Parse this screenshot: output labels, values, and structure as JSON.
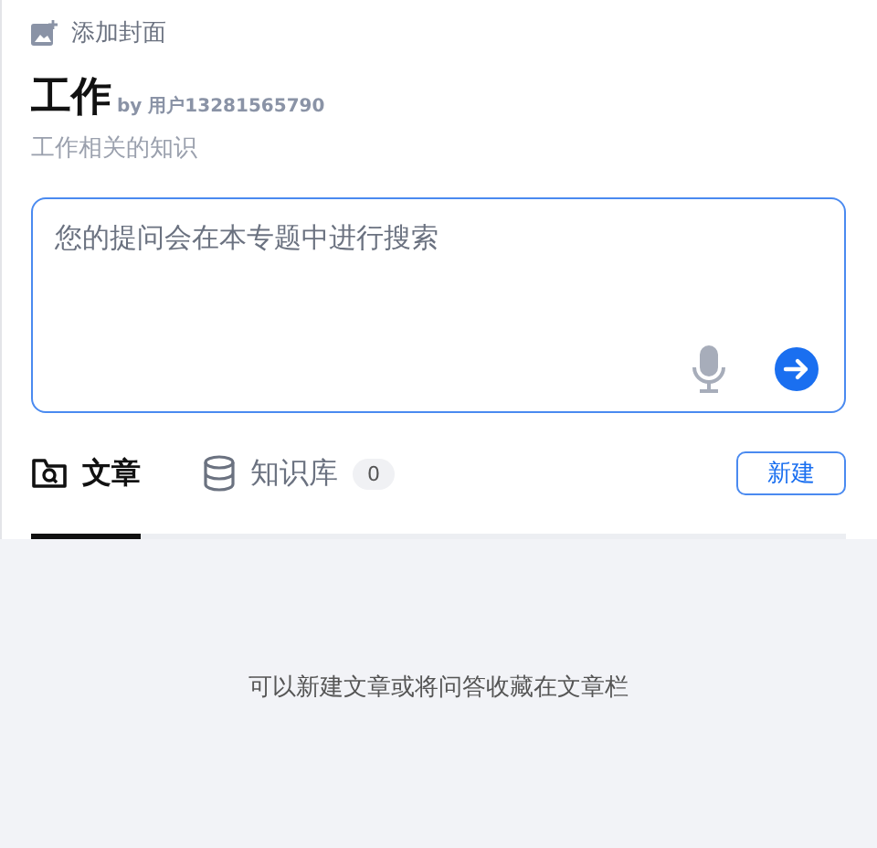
{
  "cover": {
    "label": "添加封面"
  },
  "topic": {
    "title": "工作",
    "author": "by 用户13281565790",
    "description": "工作相关的知识"
  },
  "search": {
    "placeholder": "您的提问会在本专题中进行搜索"
  },
  "tabs": [
    {
      "label": "文章",
      "selected": true,
      "kind": "articles"
    },
    {
      "label": "知识库",
      "selected": false,
      "kind": "database",
      "count": "0"
    }
  ],
  "new_button": "新建",
  "empty_message": "可以新建文章或将问答收藏在文章栏"
}
